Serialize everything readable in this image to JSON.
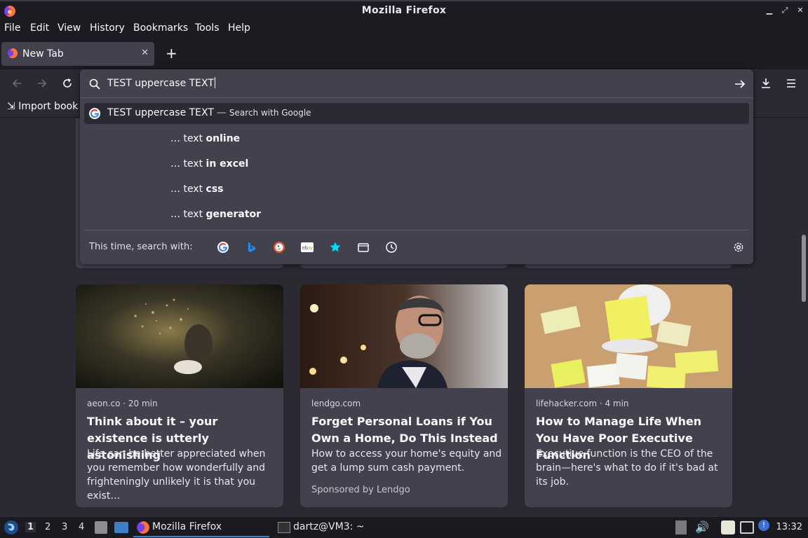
{
  "window": {
    "title": "Mozilla Firefox"
  },
  "menu": [
    "File",
    "Edit",
    "View",
    "History",
    "Bookmarks",
    "Tools",
    "Help"
  ],
  "tab": {
    "title": "New Tab"
  },
  "bookmarks": {
    "import_label": "Import book"
  },
  "urlbar": {
    "value": "TEST uppercase TEXT",
    "primary_suggestion": {
      "text": "TEST uppercase TEXT",
      "separator": "—",
      "action": "Search with Google"
    },
    "suggestions": [
      {
        "prefix": "… text ",
        "bold": "online"
      },
      {
        "prefix": "… text ",
        "bold": "in excel"
      },
      {
        "prefix": "… text ",
        "bold": "css"
      },
      {
        "prefix": "… text ",
        "bold": "generator"
      }
    ],
    "oneoff_label": "This time, search with:",
    "oneoff_engines": [
      "google-icon",
      "bing-icon",
      "duckduckgo-icon",
      "ebay-icon",
      "bookmarks-star-icon",
      "tabs-icon",
      "history-clock-icon"
    ]
  },
  "stories": [
    {
      "meta": "aeon.co · 20 min",
      "headline": "Think about it – your existence is utterly astonishing",
      "excerpt": "Life can be better appreciated when you remember how wonderfully and frighteningly unlikely it is that you exist…",
      "sponsor": ""
    },
    {
      "meta": "lendgo.com",
      "headline": "Forget Personal Loans if You Own a Home, Do This Instead",
      "excerpt": "How to access your home's equity and get a lump sum cash payment.",
      "sponsor": "Sponsored by Lendgo"
    },
    {
      "meta": "lifehacker.com · 4 min",
      "headline": "How to Manage Life When You Have Poor Executive Function",
      "excerpt": "Executive function is the CEO of the brain—here's what to do if it's bad at its job.",
      "sponsor": ""
    }
  ],
  "taskbar": {
    "workspaces": [
      "1",
      "2",
      "3",
      "4"
    ],
    "firefox_task": "Mozilla Firefox",
    "terminal_task": "dartz@VM3: ~",
    "clock": "13:32"
  },
  "colors": {
    "accent": "#3b82c4",
    "panel": "#42414d",
    "background": "#2b2a33",
    "chrome": "#1c1b22"
  }
}
